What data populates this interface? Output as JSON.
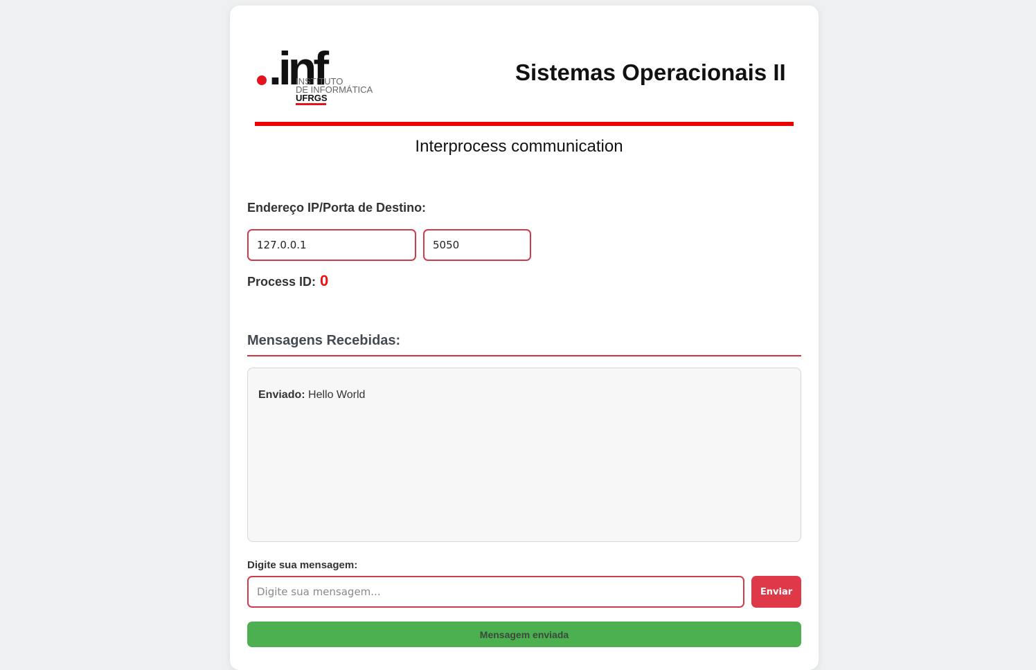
{
  "header": {
    "logo": {
      "mark": ".inf",
      "line1": "INSTITUTO",
      "line2": "DE INFORMÁTICA",
      "line3": "UFRGS"
    },
    "course_title": "Sistemas Operacionais II",
    "subtitle": "Interprocess communication"
  },
  "address": {
    "label": "Endereço IP/Porta de Destino:",
    "ip_value": "127.0.0.1",
    "port_value": "5050"
  },
  "process": {
    "label": "Process ID:",
    "value": "0"
  },
  "messages": {
    "heading": "Mensagens Recebidas:",
    "items": [
      {
        "prefix": "Enviado:",
        "text": "Hello World"
      }
    ]
  },
  "compose": {
    "label": "Digite sua mensagem:",
    "placeholder": "Digite sua mensagem...",
    "send_label": "Enviar"
  },
  "status": {
    "text": "Mensagem enviada"
  },
  "colors": {
    "accent_red": "#df3848",
    "rule_red": "#ee0000",
    "status_green": "#4caf50",
    "pid_red": "#ee1111"
  }
}
